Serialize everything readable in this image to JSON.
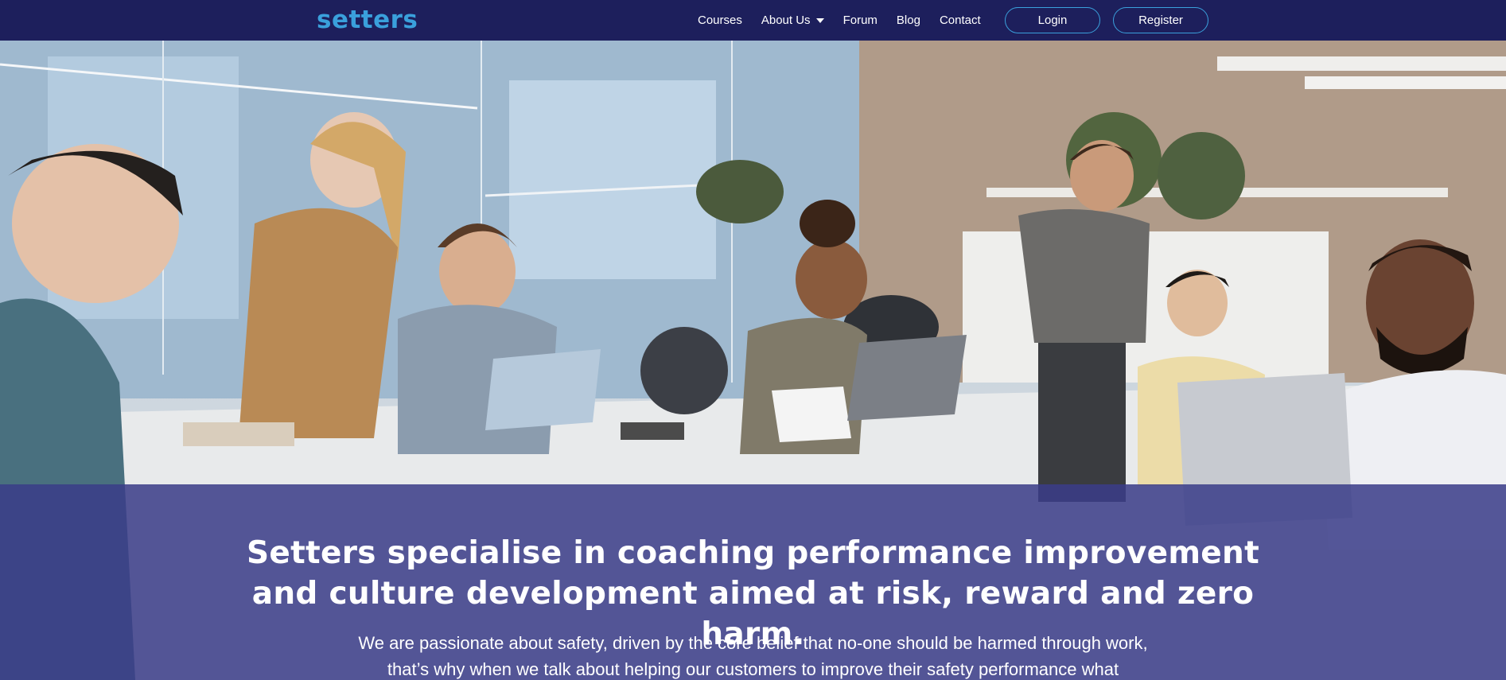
{
  "brand": {
    "logo_text": "setters"
  },
  "nav": {
    "links": [
      {
        "label": "Courses",
        "has_dropdown": false
      },
      {
        "label": "About Us",
        "has_dropdown": true
      },
      {
        "label": "Forum",
        "has_dropdown": false
      },
      {
        "label": "Blog",
        "has_dropdown": false
      },
      {
        "label": "Contact",
        "has_dropdown": false
      }
    ],
    "login_label": "Login",
    "register_label": "Register"
  },
  "hero": {
    "image_icon": "office-team-photo",
    "headline": "Setters specialise in coaching performance improvement and culture development aimed at risk, reward and zero harm.",
    "body": "We are passionate about safety, driven by the core belief that no-one should be harmed through work, that’s why when we talk about helping our customers to improve their safety performance what"
  },
  "colors": {
    "navbar_bg": "#1d1f5c",
    "logo": "#3aa0dc",
    "button_border": "#3aa0dc",
    "overlay": "#3a3d88",
    "text": "#ffffff"
  }
}
